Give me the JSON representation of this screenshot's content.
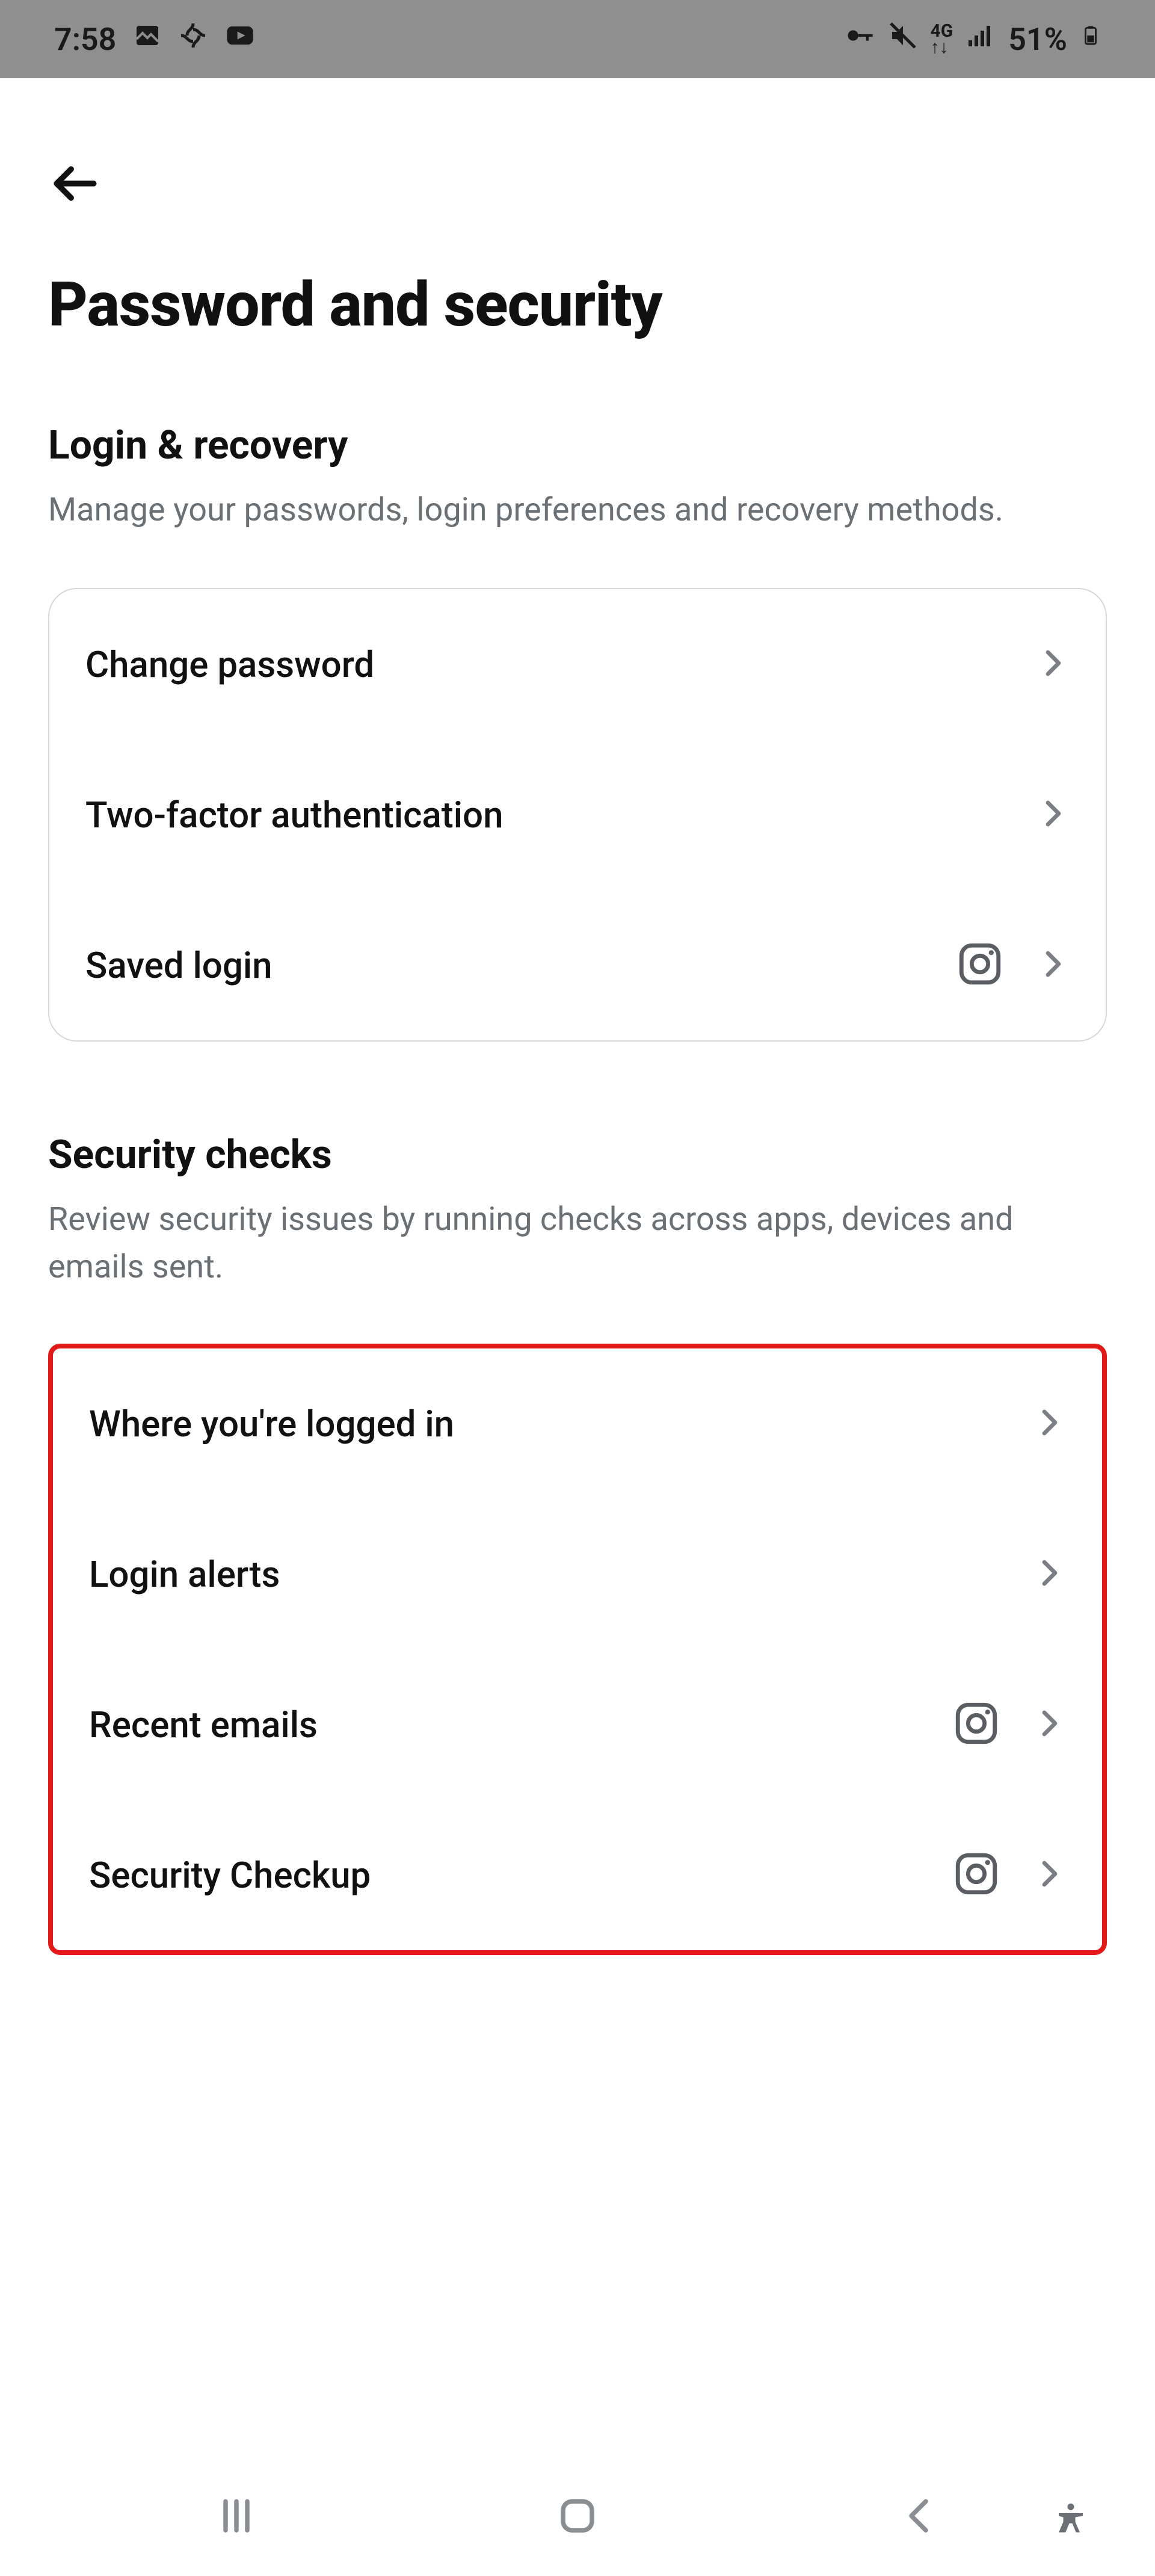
{
  "statusbar": {
    "time": "7:58",
    "battery_pct": "51%"
  },
  "page": {
    "title": "Password and security"
  },
  "sections": {
    "login": {
      "title": "Login & recovery",
      "desc": "Manage your passwords, login preferences and recovery methods.",
      "items": [
        {
          "label": "Change password",
          "has_ig": false
        },
        {
          "label": "Two-factor authentication",
          "has_ig": false
        },
        {
          "label": "Saved login",
          "has_ig": true
        }
      ]
    },
    "checks": {
      "title": "Security checks",
      "desc": "Review security issues by running checks across apps, devices and emails sent.",
      "items": [
        {
          "label": "Where you're logged in",
          "has_ig": false
        },
        {
          "label": "Login alerts",
          "has_ig": false
        },
        {
          "label": "Recent emails",
          "has_ig": true
        },
        {
          "label": "Security Checkup",
          "has_ig": true
        }
      ]
    }
  }
}
